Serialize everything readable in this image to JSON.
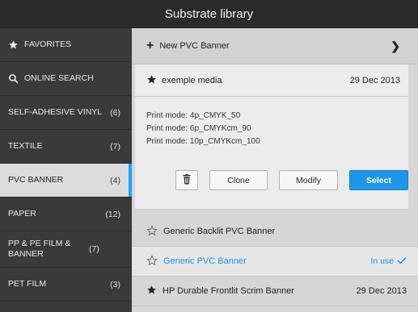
{
  "title": "Substrate library",
  "sidebar": {
    "items": [
      {
        "label": "FAVORITES",
        "count": "",
        "icon": "star-icon"
      },
      {
        "label": "ONLINE SEARCH",
        "count": "",
        "icon": "search-icon"
      },
      {
        "label": "SELF-ADHESIVE VINYL",
        "count": "(6)"
      },
      {
        "label": "TEXTILE",
        "count": "(7)"
      },
      {
        "label": "PVC BANNER",
        "count": "(4)",
        "selected": true
      },
      {
        "label": "PAPER",
        "count": "(12)"
      },
      {
        "label": "PP & PE FILM & BANNER",
        "count": "(7)"
      },
      {
        "label": "PET FILM",
        "count": "(3)"
      }
    ]
  },
  "main": {
    "new_label": "New PVC Banner",
    "card": {
      "name": "exemple media",
      "date": "29 Dec 2013",
      "modes": [
        "Print mode:  4p_CMYK_50",
        "Print mode:  6p_CMYKcm_90",
        "Print mode:  10p_CMYKcm_100"
      ],
      "clone_label": "Clone",
      "modify_label": "Modify",
      "select_label": "Select"
    },
    "rows": [
      {
        "name": "Generic Backlit PVC Banner",
        "star": "outline"
      },
      {
        "name": "Generic PVC Banner",
        "star": "outline",
        "status": "In use"
      },
      {
        "name": "HP Durable Frontlit Scrim Banner",
        "star": "filled",
        "date": "29 Dec 2013"
      }
    ]
  },
  "colors": {
    "accent": "#1e95e8",
    "title_bg": "#2b2b2b",
    "sidebar_bg": "#3a3a3a"
  }
}
